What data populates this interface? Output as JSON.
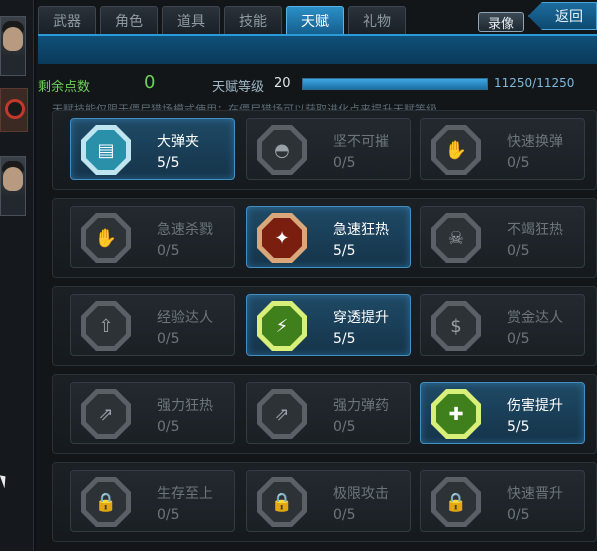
{
  "tabs": [
    {
      "label": "武器"
    },
    {
      "label": "角色"
    },
    {
      "label": "道具"
    },
    {
      "label": "技能"
    },
    {
      "label": "天赋",
      "active": true
    },
    {
      "label": "礼物"
    }
  ],
  "header": {
    "replay_label": "录像",
    "back_label": "返回"
  },
  "stats": {
    "points_label": "剩余点数",
    "points_value": "0",
    "level_label": "天赋等级",
    "level_value": "20",
    "xp_text": "11250/11250",
    "xp_fraction": 1.0
  },
  "note": "天赋技能仅限于僵尸猎场模式使用；在僵尸猎场可以获取进化点来提升天赋等级",
  "talents": [
    [
      {
        "name": "大弹夹",
        "progress": "5/5",
        "active": true,
        "icon": "magazine-icon",
        "color": "#2a8fa9"
      },
      {
        "name": "坚不可摧",
        "progress": "0/5",
        "active": false,
        "icon": "helmet-icon"
      },
      {
        "name": "快速换弹",
        "progress": "0/5",
        "active": false,
        "icon": "reload-hand-icon"
      }
    ],
    [
      {
        "name": "急速杀戮",
        "progress": "0/5",
        "active": false,
        "icon": "fast-kill-icon"
      },
      {
        "name": "急速狂热",
        "progress": "5/5",
        "active": true,
        "icon": "rage-blade-icon",
        "color": "#7a1e10"
      },
      {
        "name": "不竭狂热",
        "progress": "0/5",
        "active": false,
        "icon": "skull-icon"
      }
    ],
    [
      {
        "name": "经验达人",
        "progress": "0/5",
        "active": false,
        "icon": "exp-up-icon"
      },
      {
        "name": "穿透提升",
        "progress": "5/5",
        "active": true,
        "icon": "pierce-icon",
        "color": "#3f7f1c"
      },
      {
        "name": "赏金达人",
        "progress": "0/5",
        "active": false,
        "icon": "bounty-coin-icon"
      }
    ],
    [
      {
        "name": "强力狂热",
        "progress": "0/5",
        "active": false,
        "icon": "power-rage-icon"
      },
      {
        "name": "强力弹药",
        "progress": "0/5",
        "active": false,
        "icon": "power-ammo-icon"
      },
      {
        "name": "伤害提升",
        "progress": "5/5",
        "active": true,
        "icon": "rifle-damage-icon",
        "color": "#3f7f1c"
      }
    ],
    [
      {
        "name": "生存至上",
        "progress": "0/5",
        "active": false,
        "icon": "lock-icon"
      },
      {
        "name": "极限攻击",
        "progress": "0/5",
        "active": false,
        "icon": "lock-icon"
      },
      {
        "name": "快速晋升",
        "progress": "0/5",
        "active": false,
        "icon": "lock-icon"
      }
    ]
  ]
}
